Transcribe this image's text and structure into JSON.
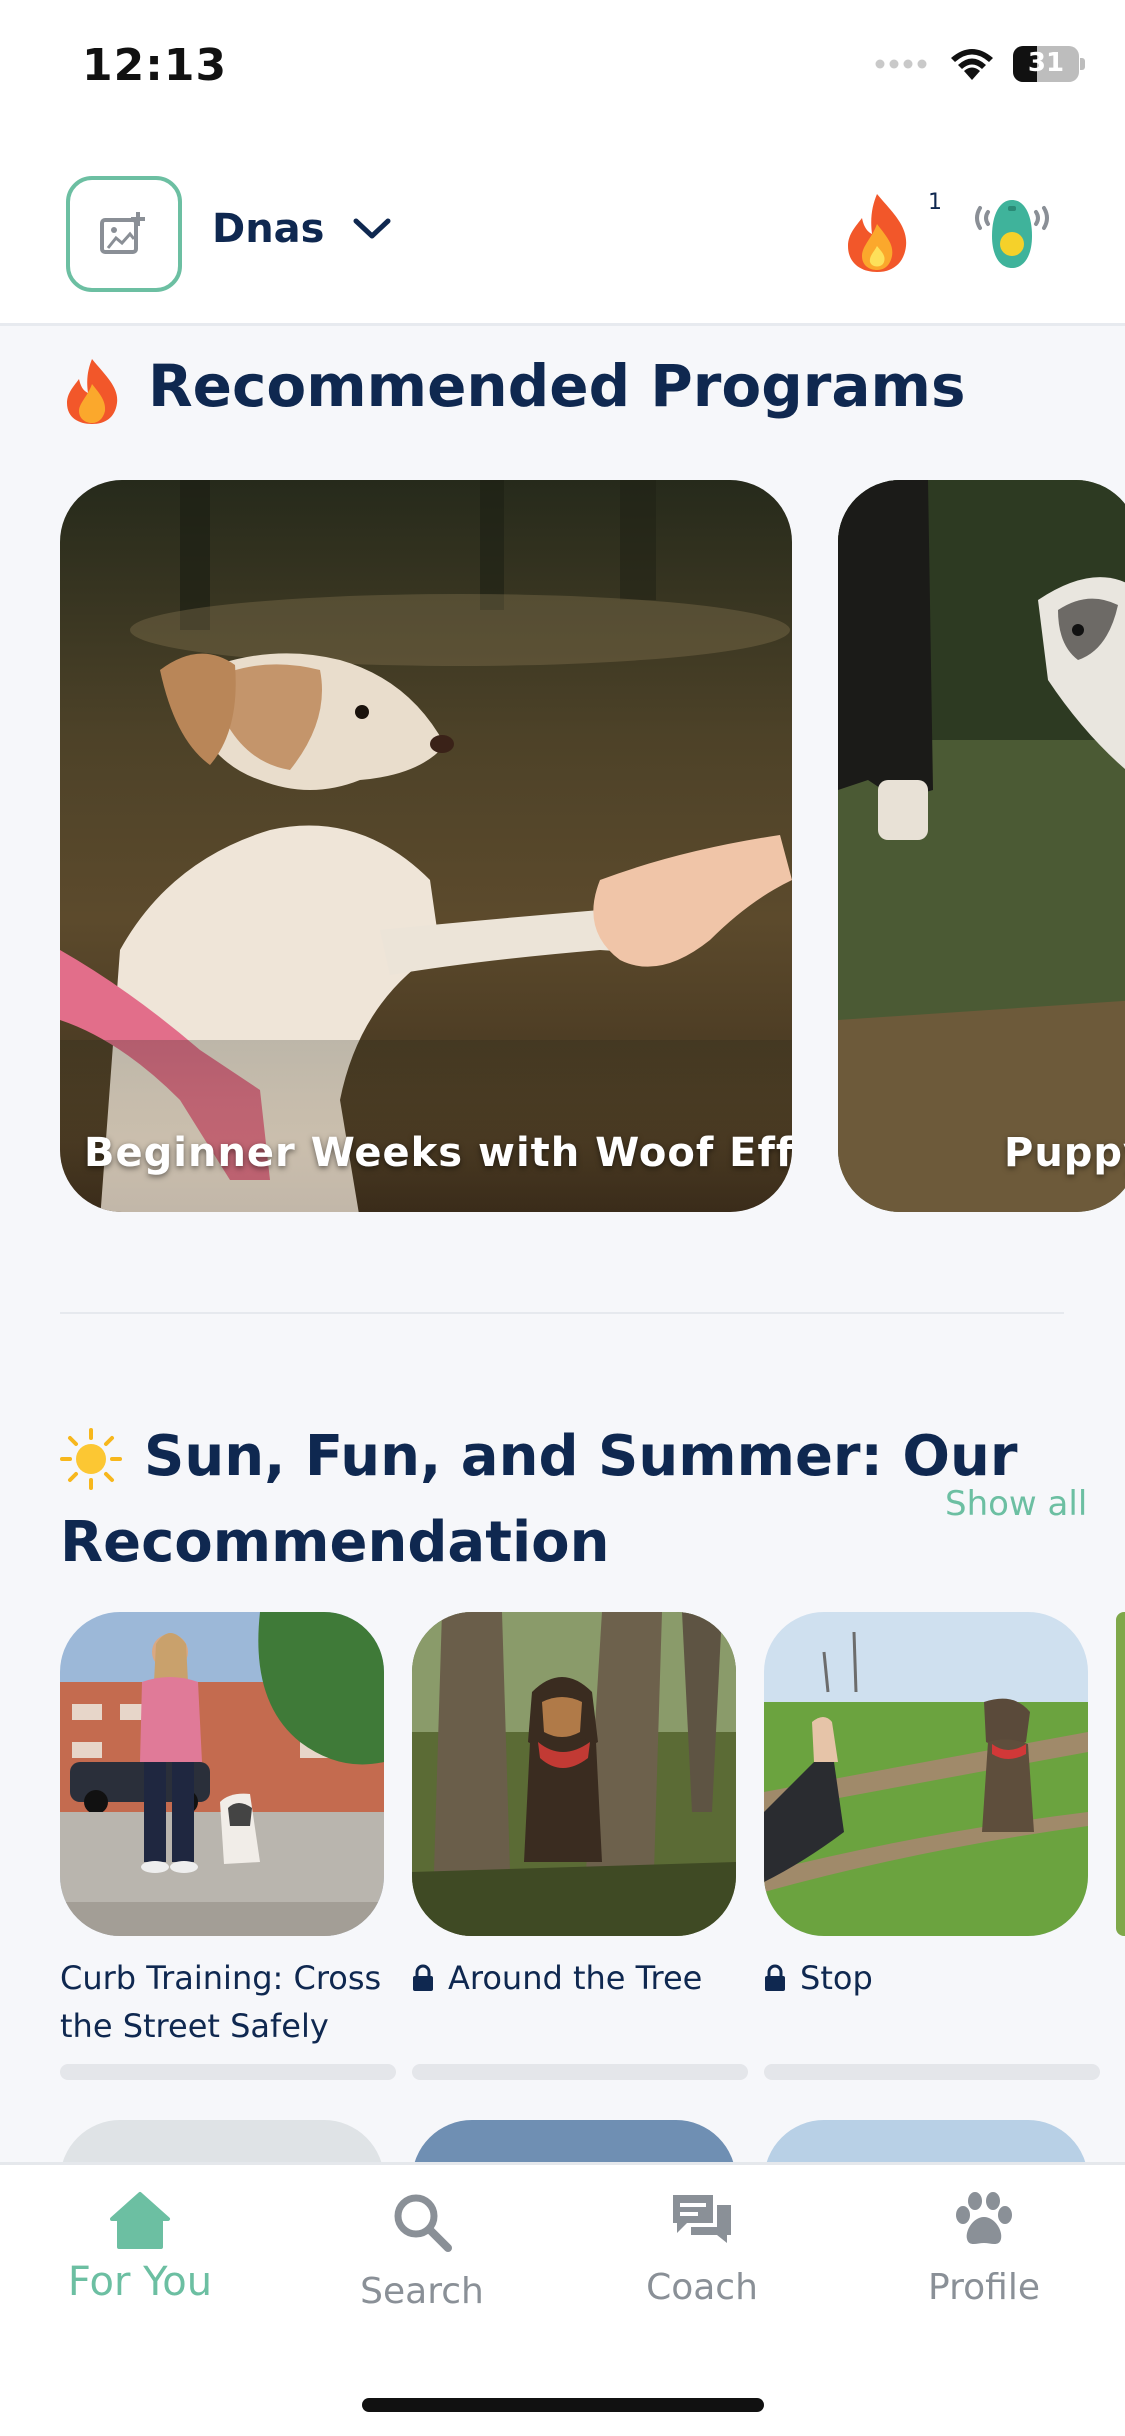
{
  "status": {
    "time": "12:13",
    "battery": "31"
  },
  "header": {
    "dog_name": "Dnas",
    "streak_count": "1"
  },
  "recommended": {
    "title": "Recommended Programs",
    "programs": [
      {
        "label": "Beginner Weeks with Woof Effect"
      },
      {
        "label": "Puppy"
      }
    ]
  },
  "summer": {
    "title_line1": "Sun, Fun, and Summer: Our",
    "title_line2": "Recommendation",
    "show_all": "Show all",
    "exercises": [
      {
        "title": "Curb Training: Cross the Street Safely",
        "locked": false
      },
      {
        "title": "Around the Tree",
        "locked": true
      },
      {
        "title": "Stop",
        "locked": true
      }
    ]
  },
  "tabs": [
    {
      "label": "For You",
      "icon": "home-icon",
      "active": true
    },
    {
      "label": "Search",
      "icon": "search-icon",
      "active": false
    },
    {
      "label": "Coach",
      "icon": "chat-icon",
      "active": false
    },
    {
      "label": "Profile",
      "icon": "paw-icon",
      "active": false
    }
  ],
  "colors": {
    "accent": "#6cbfa2",
    "navy": "#0f2850",
    "inactive": "#8a9097"
  }
}
